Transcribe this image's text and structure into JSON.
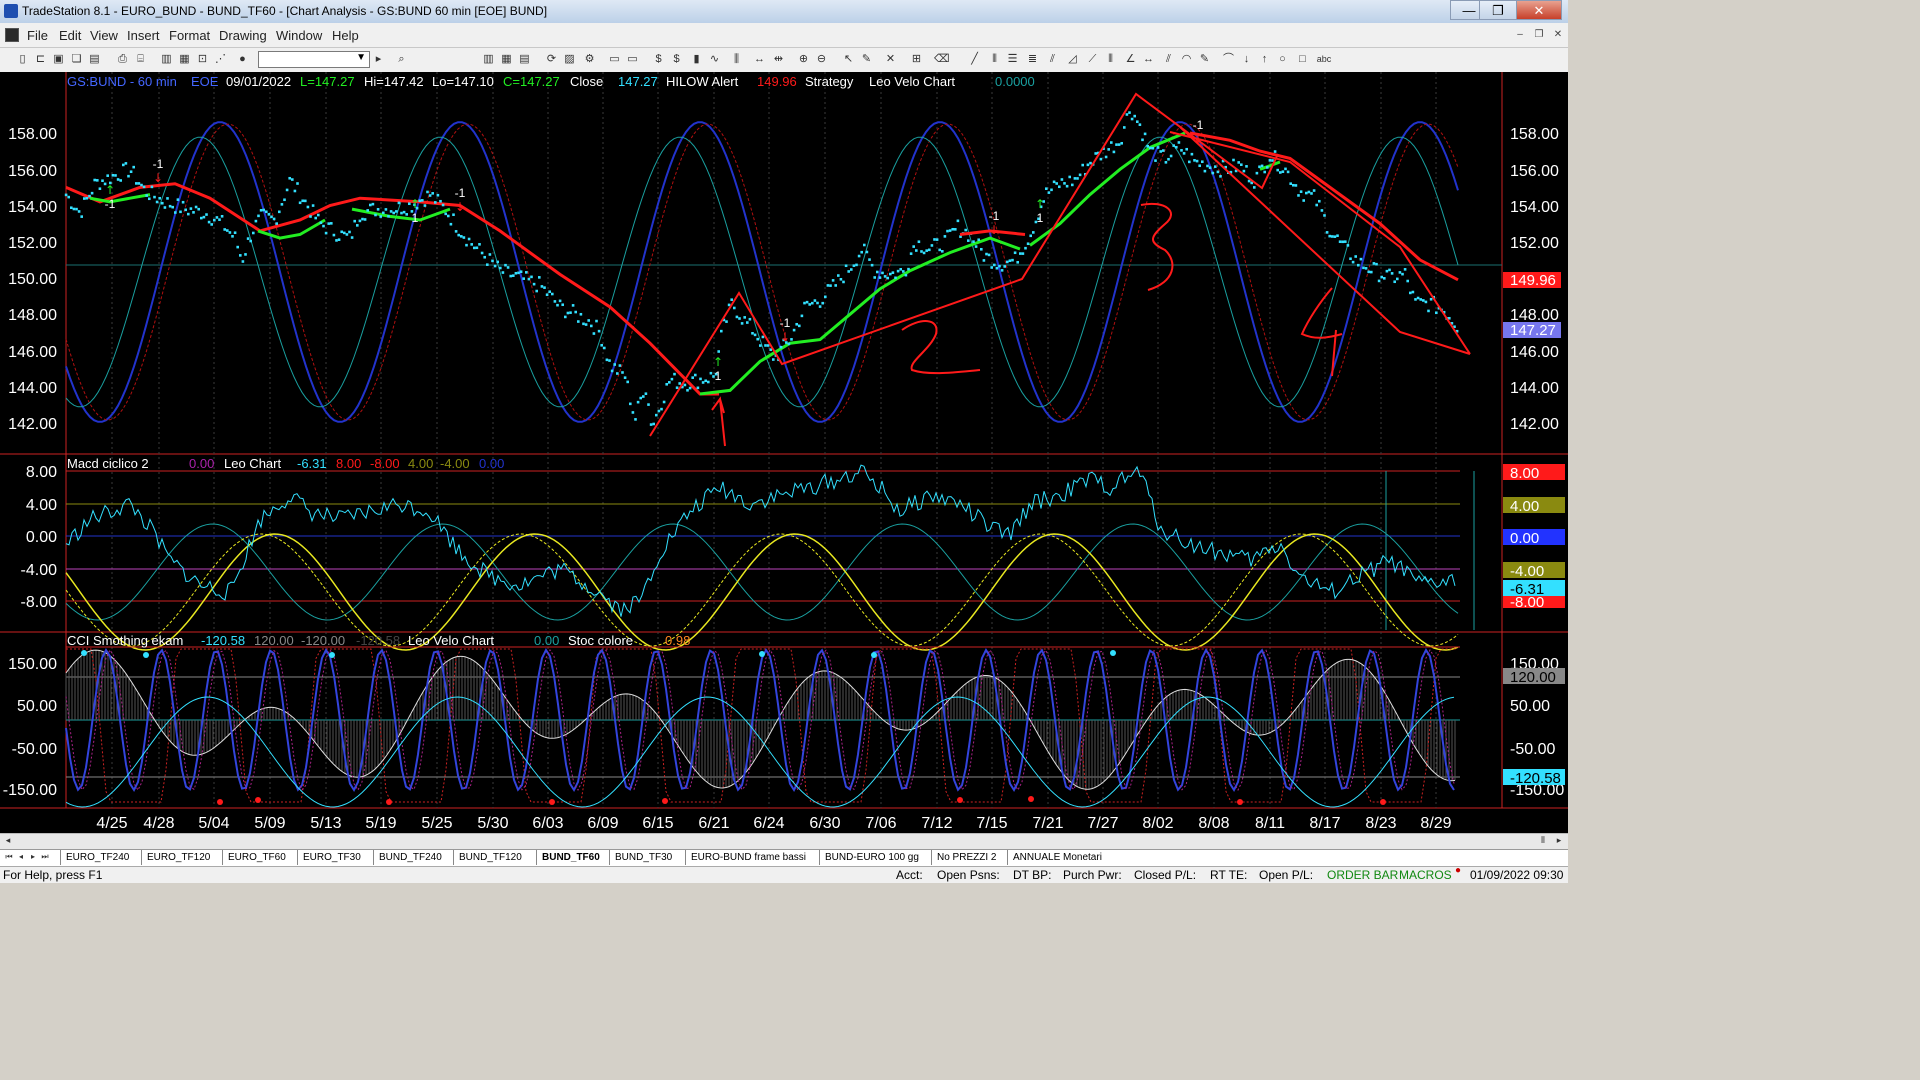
{
  "window": {
    "title": "TradeStation 8.1 - EURO_BUND - BUND_TF60 - [Chart Analysis - GS:BUND  60 min  [EOE] BUND]",
    "minimize": "—",
    "restore": "❐",
    "close": "✕"
  },
  "menu": {
    "items": [
      "File",
      "Edit",
      "View",
      "Insert",
      "Format",
      "Drawing",
      "Window",
      "Help"
    ],
    "mdi_min": "–",
    "mdi_restore": "❐",
    "mdi_close": "✕"
  },
  "toolbar": {
    "icons": [
      "new-icon",
      "open-icon",
      "save-icon",
      "copy-icon",
      "print-icon",
      "print-preview-icon",
      "chart-icon",
      "grid-icon",
      "lock-icon",
      "indicator-icon",
      "strategy-icon",
      "zoom-in-icon",
      "zoom-out-icon",
      "pointer-icon",
      "crosshair-icon",
      "trendline-icon",
      "text-icon"
    ],
    "combo_value": ""
  },
  "price_panel": {
    "header": {
      "symbol": "GS:BUND - 60 min",
      "session": "EOE",
      "date": "09/01/2022",
      "low_label": "L=147.27",
      "hi_label": "Hi=147.42",
      "lo_label": "Lo=147.10",
      "close_label": "C=147.27",
      "close_word": "Close",
      "close_val": "147.27",
      "hilow": "HILOW Alert",
      "hilow_val": "149.96",
      "strategy": "Strategy",
      "leo": "Leo Velo Chart",
      "leo_val": "0.0000"
    },
    "y_ticks": [
      "158.00",
      "156.00",
      "154.00",
      "152.00",
      "150.00",
      "148.00",
      "146.00",
      "144.00",
      "142.00"
    ],
    "right_ticks": [
      "158.00",
      "156.00",
      "154.00",
      "152.00",
      "148.00",
      "146.00",
      "144.00",
      "142.00"
    ],
    "badge_red": "149.96",
    "badge_last": "147.27",
    "markers": [
      "-1",
      "-1",
      "-1",
      "1",
      "-1",
      "-1",
      "-1",
      "1",
      "1"
    ]
  },
  "macd_panel": {
    "title": "Macd ciclico 2",
    "v1": "0.00",
    "leo": "Leo Chart",
    "v2": "-6.31",
    "v3": "8.00",
    "v4": "-8.00",
    "v5": "4.00",
    "v6": "-4.00",
    "v7": "0.00",
    "y_ticks": [
      "8.00",
      "4.00",
      "0.00",
      "-4.00",
      "-8.00"
    ],
    "badges": [
      "8.00",
      "4.00",
      "0.00",
      "-4.00",
      "-6.31",
      "-8.00"
    ]
  },
  "cci_panel": {
    "title": "CCI Smothing ekam",
    "v1": "-120.58",
    "v2": "120.00",
    "v3": "-120.00",
    "v4": "-120.58",
    "leo": "Leo Velo Chart",
    "v5": "0.00",
    "stoc": "Stoc colore",
    "v6": "0.98",
    "y_ticks": [
      "150.00",
      "50.00",
      "-50.00",
      "-150.00"
    ],
    "badges": [
      "150.00",
      "120.00",
      "50.00",
      "-50.00",
      "-120.58",
      "-150.00"
    ]
  },
  "x_ticks": [
    "4/25",
    "4/28",
    "5/04",
    "5/09",
    "5/13",
    "5/19",
    "5/25",
    "5/30",
    "6/03",
    "6/09",
    "6/15",
    "6/21",
    "6/24",
    "6/30",
    "7/06",
    "7/12",
    "7/15",
    "7/21",
    "7/27",
    "8/02",
    "8/08",
    "8/11",
    "8/17",
    "8/23",
    "8/29"
  ],
  "tabs": [
    "EURO_TF240",
    "EURO_TF120",
    "EURO_TF60",
    "EURO_TF30",
    "BUND_TF240",
    "BUND_TF120",
    "BUND_TF60",
    "BUND_TF30",
    "EURO-BUND frame bassi",
    "BUND-EURO 100 gg",
    "No PREZZI 2",
    "ANNUALE Monetari"
  ],
  "active_tab": "BUND_TF60",
  "status": {
    "help": "For Help, press F1",
    "acct": "Acct:",
    "open_psns": "Open Psns:",
    "dt_bp": "DT BP:",
    "purch_pwr": "Purch Pwr:",
    "closed_pl": "Closed P/L:",
    "rt_te": "RT TE:",
    "open_pl": "Open P/L:",
    "order_bar": "ORDER BAR",
    "macros": "MACROS",
    "datetime": "01/09/2022 09:30"
  },
  "colors": {
    "cyan": "#33e0ff",
    "red": "#ff1a1a",
    "green": "#22ee22",
    "blue": "#2233cc",
    "teal": "#1aa0a0",
    "yellow": "#e8e820",
    "grid": "#3a3a3a"
  }
}
